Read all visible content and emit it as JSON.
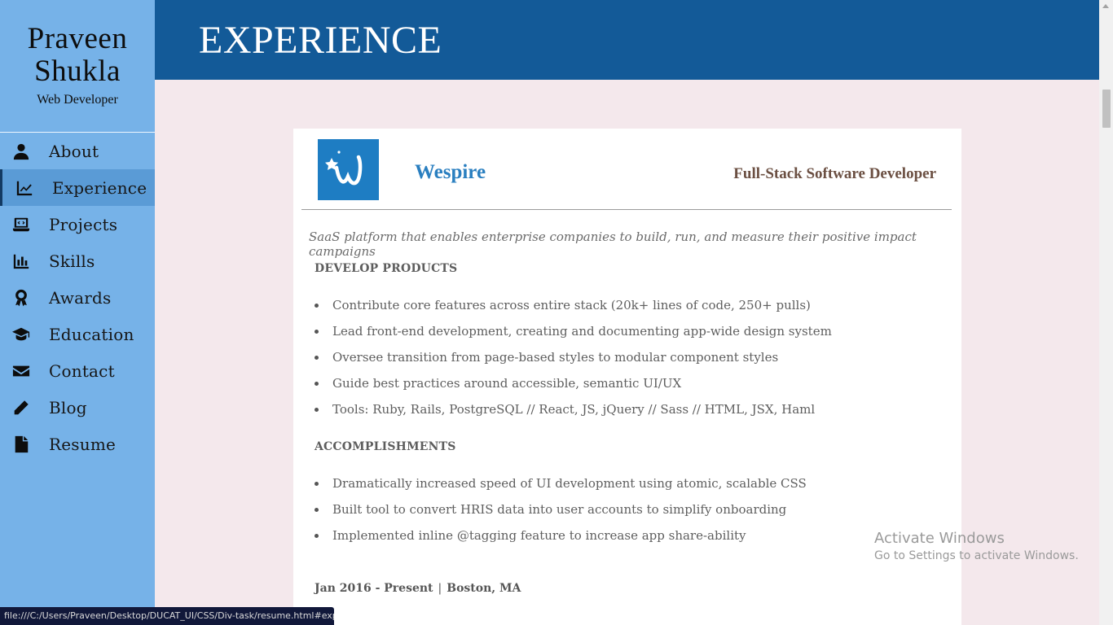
{
  "sidebar": {
    "name": "Praveen Shukla",
    "role": "Web Developer",
    "items": [
      {
        "label": "About",
        "icon": "user-icon"
      },
      {
        "label": "Experience",
        "icon": "chart-line-icon",
        "active": true
      },
      {
        "label": "Projects",
        "icon": "laptop-code-icon"
      },
      {
        "label": "Skills",
        "icon": "bar-chart-icon"
      },
      {
        "label": "Awards",
        "icon": "award-icon"
      },
      {
        "label": "Education",
        "icon": "graduation-cap-icon"
      },
      {
        "label": "Contact",
        "icon": "envelope-icon"
      },
      {
        "label": "Blog",
        "icon": "pencil-icon"
      },
      {
        "label": "Resume",
        "icon": "file-icon"
      }
    ]
  },
  "header": {
    "title": "EXPERIENCE"
  },
  "experience": {
    "company": "Wespire",
    "logo_icon": "wespire-logo",
    "role": "Full-Stack Software Developer",
    "tagline": "SaaS platform that enables enterprise companies to build, run, and measure their positive impact campaigns",
    "sections": [
      {
        "heading": "DEVELOP PRODUCTS",
        "items": [
          "Contribute core features across entire stack (20k+ lines of code, 250+ pulls)",
          "Lead front-end development, creating and documenting app-wide design system",
          "Oversee transition from page-based styles to modular component styles",
          "Guide best practices around accessible, semantic UI/UX",
          "Tools: Ruby, Rails, PostgreSQL // React, JS, jQuery // Sass // HTML, JSX, Haml"
        ]
      },
      {
        "heading": "ACCOMPLISHMENTS",
        "items": [
          "Dramatically increased speed of UI development using atomic, scalable CSS",
          "Built tool to convert HRIS data into user accounts to simplify onboarding",
          "Implemented inline @tagging feature to increase app share-ability"
        ]
      }
    ],
    "dates": "Jan 2016 - Present",
    "separator": "|",
    "location": "Boston, MA"
  },
  "watermark": {
    "title": "Activate Windows",
    "subtitle": "Go to Settings to activate Windows."
  },
  "status_url": "file:///C:/Users/Praveen/Desktop/DUCAT_UI/CSS/Div-task/resume.html#exp",
  "colors": {
    "sidebar": "#76b2e8",
    "header": "#135a98",
    "page_bg": "#f4e8ec",
    "company": "#2a7fc0",
    "role": "#6b4f42"
  }
}
